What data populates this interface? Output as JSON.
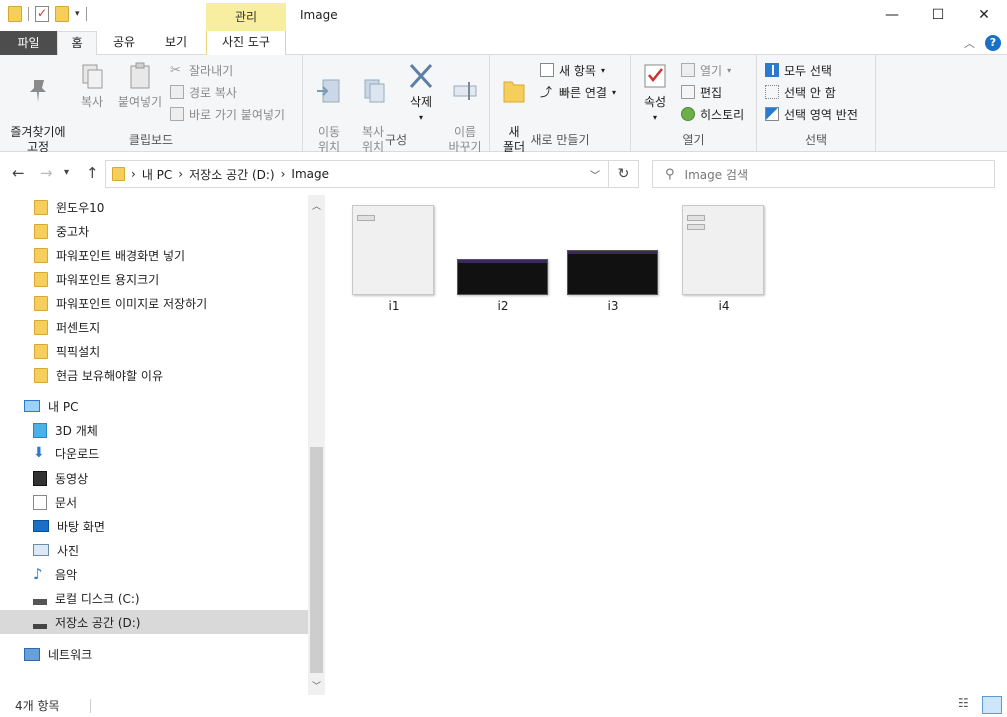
{
  "titlebar": {
    "title": "Image",
    "context_tab": "관리",
    "controls": {
      "minimize": "—",
      "maximize": "☐",
      "close": "✕"
    }
  },
  "tabs": {
    "file": "파일",
    "home": "홈",
    "share": "공유",
    "view": "보기",
    "photo_tools": "사진 도구"
  },
  "ribbon": {
    "clipboard": {
      "label": "클립보드",
      "pin": "즐겨찾기에\n고정",
      "copy": "복사",
      "paste": "붙여넣기",
      "cut": "잘라내기",
      "copy_path": "경로 복사",
      "paste_shortcut": "바로 가기 붙여넣기"
    },
    "organize": {
      "label": "구성",
      "move": "이동\n위치",
      "copy_to": "복사\n위치",
      "delete": "삭제",
      "rename": "이름\n바꾸기"
    },
    "new": {
      "label": "새로 만들기",
      "new_folder": "새\n폴더",
      "new_item": "새 항목",
      "easy_access": "빠른 연결"
    },
    "open": {
      "label": "열기",
      "properties": "속성",
      "open": "열기",
      "edit": "편집",
      "history": "히스토리"
    },
    "select": {
      "label": "선택",
      "select_all": "모두 선택",
      "select_none": "선택 안 함",
      "invert": "선택 영역 반전"
    }
  },
  "address": {
    "crumbs": [
      "내 PC",
      "저장소 공간 (D:)",
      "Image"
    ],
    "search_placeholder": "Image 검색"
  },
  "navpane": {
    "folders": [
      "윈도우10",
      "중고차",
      "파워포인트 배경화면 넣기",
      "파워포인트 용지크기",
      "파워포인트 이미지로 저장하기",
      "퍼센트지",
      "픽픽설치",
      "현금 보유해야할 이유"
    ],
    "this_pc": "내 PC",
    "pc_items": [
      "3D 개체",
      "다운로드",
      "동영상",
      "문서",
      "바탕 화면",
      "사진",
      "음악",
      "로컬 디스크 (C:)",
      "저장소 공간 (D:)"
    ],
    "network": "네트워크"
  },
  "files": [
    {
      "name": "i1",
      "style": "light"
    },
    {
      "name": "i2",
      "style": "dark"
    },
    {
      "name": "i3",
      "style": "dark"
    },
    {
      "name": "i4",
      "style": "light"
    }
  ],
  "status": {
    "count": "4개 항목"
  },
  "colors": {
    "accent": "#1979ca",
    "context_tab": "#f8eea0",
    "folder": "#f6ce5b",
    "selected": "#d9d9d9"
  }
}
